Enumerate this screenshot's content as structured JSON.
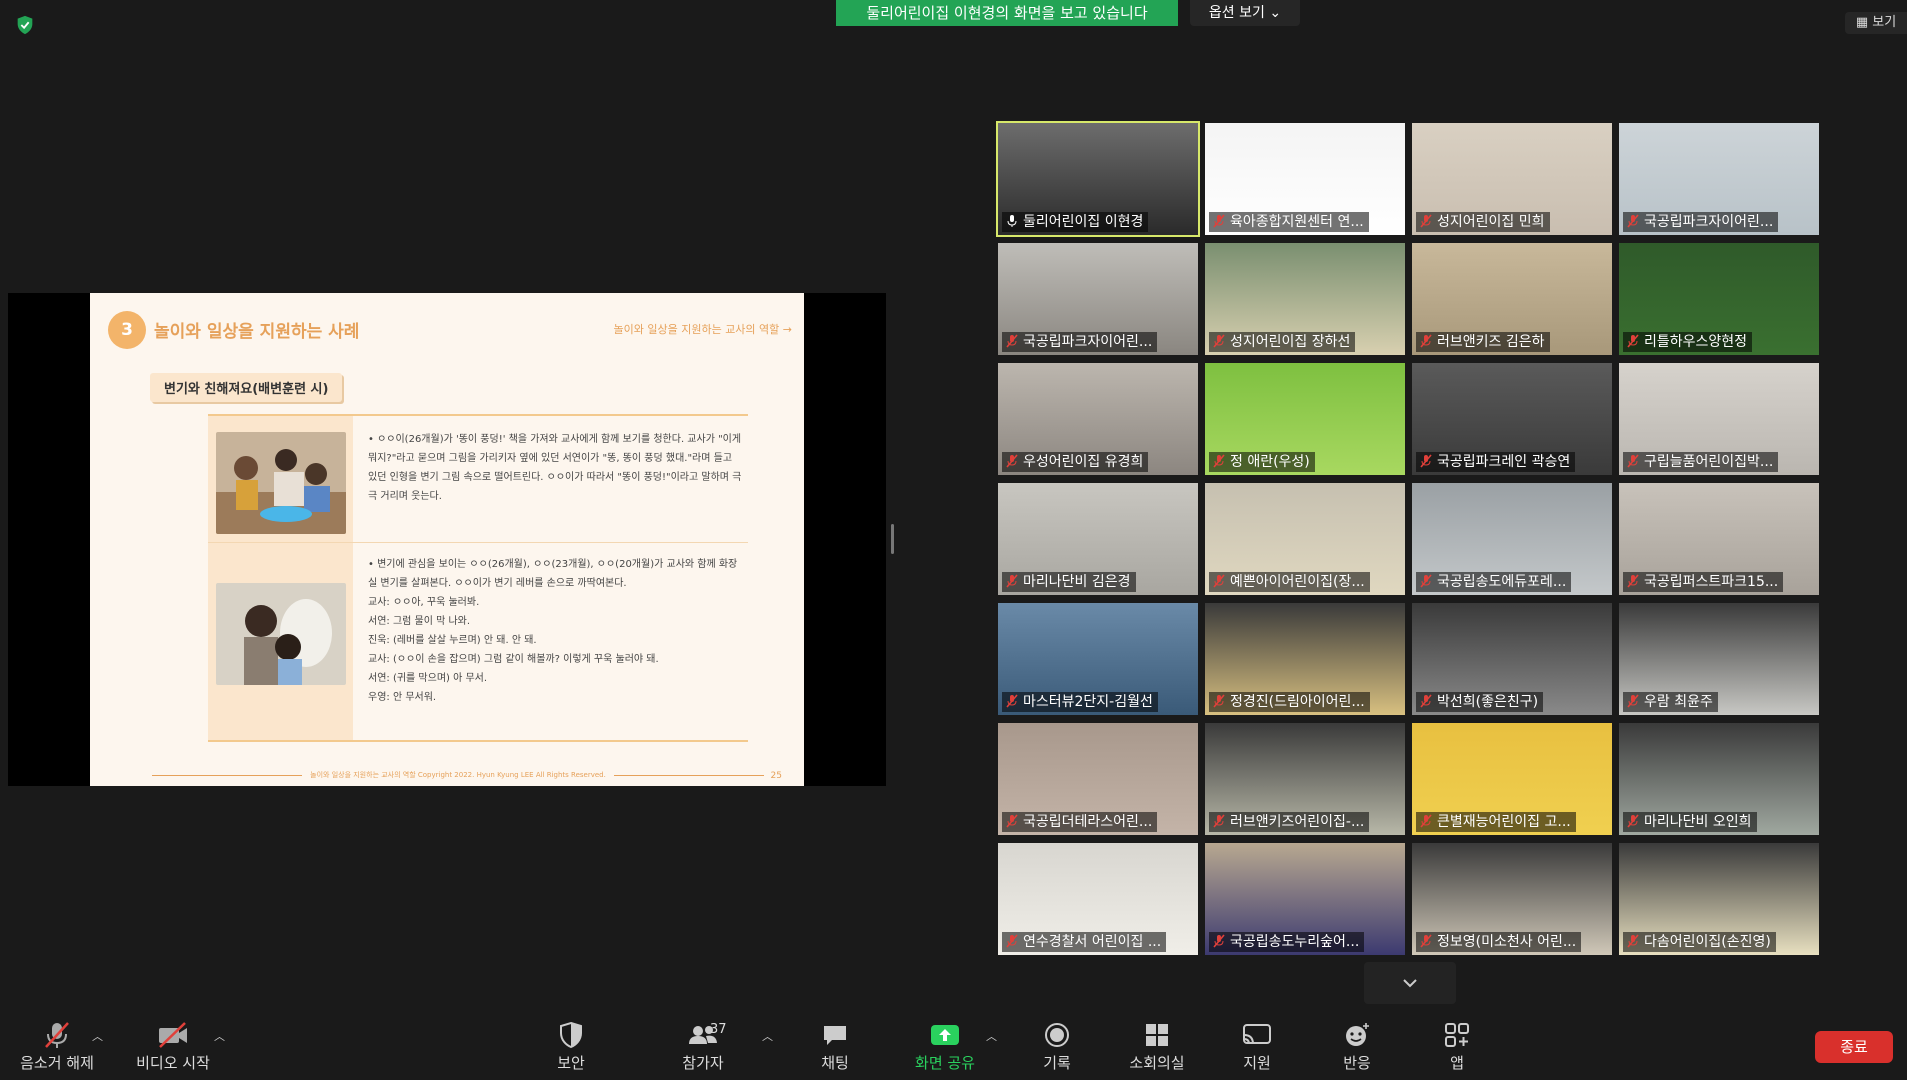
{
  "banner": {
    "sharing_text": "둘리어린이집 이현경의 화면을 보고 있습니다",
    "options_label": "옵션 보기",
    "view_label": "보기"
  },
  "slide": {
    "number": "3",
    "title": "놀이와 일상을 지원하는 사례",
    "subtitle": "놀이와 일상을 지원하는 교사의 역할 →",
    "section": "변기와 친해져요(배변훈련 시)",
    "case1": "• ㅇㅇ이(26개월)가 '똥이 풍덩!' 책을 가져와 교사에게 함께 보기를 청한다. 교사가 \"이게 뭐지?\"라고 묻으며 그림을 가리키자 옆에 있던 서연이가 \"똥, 똥이 풍덩 했대.\"라며 들고 있던 인형을 변기 그림 속으로 떨어트린다. ㅇㅇ이가 따라서 \"똥이 풍덩!\"이라고 말하며 극극 거리며 웃는다.",
    "case2_lines": [
      "• 변기에 관심을 보이는 ㅇㅇ(26개월), ㅇㅇ(23개월), ㅇㅇ(20개월)가 교사와 함께 화장실 변기를 살펴본다. ㅇㅇ이가 변기 레버를 손으로 까딱여본다.",
      "교사: ㅇㅇ아, 꾸욱 눌러봐.",
      "서연: 그럼 물이 막 나와.",
      "진욱: (레버를 살살 누르며) 안 돼. 안 돼.",
      "교사: (ㅇㅇ이 손을 잡으며) 그럼 같이 해볼까? 이렇게 꾸욱 눌러야 돼.",
      "서연: (귀를 막으며) 아 무서.",
      "우영: 안 무서워."
    ],
    "footer": "놀이와 일상을 지원하는 교사의 역할 Copyright 2022. Hyun Kyung LEE All Rights Reserved.",
    "page": "25"
  },
  "participants": [
    {
      "name": "둘리어린이집 이현경",
      "active": true
    },
    {
      "name": "육아종합지원센터 연..."
    },
    {
      "name": "성지어린이집 민희"
    },
    {
      "name": "국공립파크자이어린..."
    },
    {
      "name": "국공립파크자이어린..."
    },
    {
      "name": "성지어린이집 장하선"
    },
    {
      "name": "러브앤키즈 김은하"
    },
    {
      "name": "리틀하우스양현정"
    },
    {
      "name": "우성어린이집 유경희"
    },
    {
      "name": "정 애란(우성)"
    },
    {
      "name": "국공립파크레인 곽승연"
    },
    {
      "name": "구립늘품어린이집박..."
    },
    {
      "name": "마리나단비 김은경"
    },
    {
      "name": "예쁜아이어린이집(장..."
    },
    {
      "name": "국공립송도에듀포레..."
    },
    {
      "name": "국공립퍼스트파크15..."
    },
    {
      "name": "마스터뷰2단지-김월선"
    },
    {
      "name": "정경진(드림아이어린..."
    },
    {
      "name": "박선희(좋은친구)"
    },
    {
      "name": "우람 최윤주"
    },
    {
      "name": "국공립더테라스어린..."
    },
    {
      "name": "러브앤키즈어린이집-..."
    },
    {
      "name": "큰별재능어린이집 고..."
    },
    {
      "name": "마리나단비 오인희"
    },
    {
      "name": "연수경찰서 어린이집 ..."
    },
    {
      "name": "국공립송도누리숲어..."
    },
    {
      "name": "정보영(미소천사 어린..."
    },
    {
      "name": "다솜어린이집(손진영)"
    }
  ],
  "toolbar": {
    "unmute": "음소거 해제",
    "start_video": "비디오 시작",
    "security": "보안",
    "participants": "참가자",
    "participants_count": "37",
    "chat": "채팅",
    "share_screen": "화면 공유",
    "record": "기록",
    "breakout": "소회의실",
    "support": "지원",
    "reactions": "반응",
    "apps": "앱",
    "end": "종료"
  },
  "colors": {
    "share_green": "#23a455",
    "active_speaker": "#d7e86a",
    "end_red": "#d9302c",
    "slide_accent": "#e6a15a"
  }
}
